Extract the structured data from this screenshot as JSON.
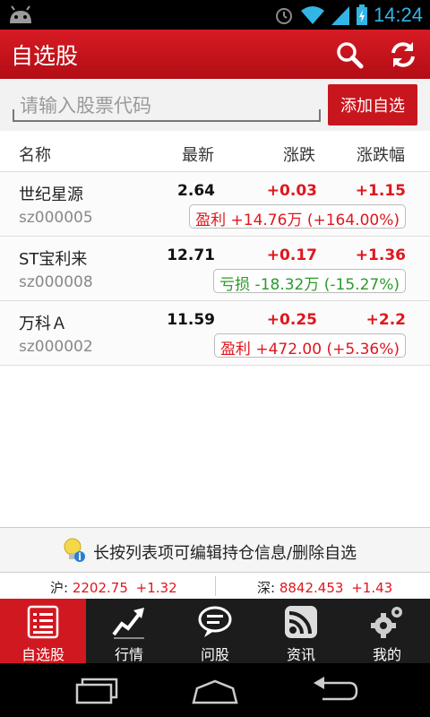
{
  "status_bar": {
    "time": "14:24"
  },
  "app_bar": {
    "title": "自选股"
  },
  "search": {
    "placeholder": "请输入股票代码",
    "add_button": "添加自选"
  },
  "table": {
    "columns": [
      "名称",
      "最新",
      "涨跌",
      "涨跌幅"
    ],
    "rows": [
      {
        "name": "世纪星源",
        "code": "sz000005",
        "price": "2.64",
        "change": "+0.03",
        "change_pct": "+1.15",
        "pl": "盈利  +14.76万  (+164.00%)",
        "pl_type": "profit"
      },
      {
        "name": "ST宝利来",
        "code": "sz000008",
        "price": "12.71",
        "change": "+0.17",
        "change_pct": "+1.36",
        "pl": "亏损  -18.32万  (-15.27%)",
        "pl_type": "loss"
      },
      {
        "name": "万科Ａ",
        "code": "sz000002",
        "price": "11.59",
        "change": "+0.25",
        "change_pct": "+2.2",
        "pl": "盈利  +472.00  (+5.36%)",
        "pl_type": "profit"
      }
    ]
  },
  "hint": {
    "text": "长按列表项可编辑持仓信息/删除自选"
  },
  "indices": {
    "sh": {
      "label": "沪:",
      "value": "2202.75",
      "change": "+1.32"
    },
    "sz": {
      "label": "深:",
      "value": "8842.453",
      "change": "+1.43"
    }
  },
  "tabs": [
    {
      "label": "自选股",
      "icon": "watchlist-icon"
    },
    {
      "label": "行情",
      "icon": "market-chart-icon"
    },
    {
      "label": "问股",
      "icon": "chat-bubble-icon"
    },
    {
      "label": "资讯",
      "icon": "news-feed-icon"
    },
    {
      "label": "我的",
      "icon": "gear-icon"
    }
  ],
  "colors": {
    "brand_red": "#d01820",
    "up": "#e0161e",
    "down": "#2a9b2a",
    "status_blue": "#33b5e5"
  }
}
